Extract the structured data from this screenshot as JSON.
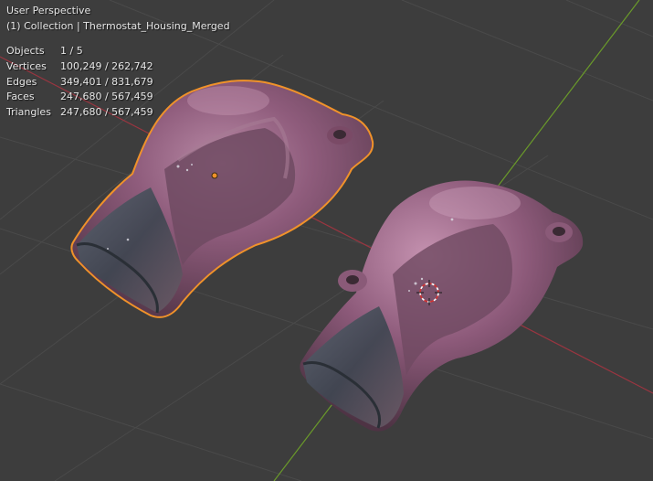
{
  "viewport": {
    "view_name": "User Perspective",
    "collection": "(1) Collection | Thermostat_Housing_Merged"
  },
  "stats": [
    {
      "label": "Objects",
      "value": "1 / 5"
    },
    {
      "label": "Vertices",
      "value": "100,249 / 262,742"
    },
    {
      "label": "Edges",
      "value": "349,401 / 831,679"
    },
    {
      "label": "Faces",
      "value": "247,680 / 567,459"
    },
    {
      "label": "Triangles",
      "value": "247,680 / 567,459"
    }
  ],
  "colors": {
    "background": "#3d3d3d",
    "grid": "#4a4a4a",
    "x_axis": "#9b3540",
    "y_axis": "#6a9a2a",
    "selection_outline": "#f0922a",
    "mesh_base": "#8a5a7a"
  },
  "icons": {
    "origin_marker": "origin-dot-icon",
    "cursor_3d": "3d-cursor-icon"
  }
}
